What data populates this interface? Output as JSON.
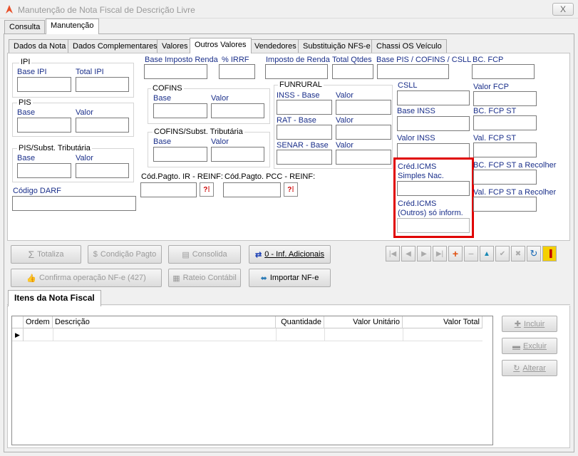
{
  "window": {
    "title": "Manutenção de Nota Fiscal de Descrição Livre",
    "close": "X"
  },
  "top_tabs": [
    "Consulta",
    "Manutenção"
  ],
  "sub_tabs": [
    "Dados da Nota",
    "Dados Complementares",
    "Valores",
    "Outros Valores",
    "Vendedores",
    "Substituição NFS-e",
    "Chassi OS Veículo"
  ],
  "fields": {
    "ipi": "IPI",
    "base_ipi": "Base IPI",
    "total_ipi": "Total IPI",
    "pis": "PIS",
    "pis_base": "Base",
    "pis_valor": "Valor",
    "pis_subst": "PIS/Subst. Tributária",
    "pis_subst_base": "Base",
    "pis_subst_valor": "Valor",
    "codigo_darf": "Código DARF",
    "base_ir": "Base Imposto Renda",
    "irrf": "% IRRF",
    "imposto_renda": "Imposto de Renda",
    "total_qtdes": "Total Qtdes",
    "base_pis_cofins_csll": "Base PIS / COFINS / CSLL",
    "bc_fcp": "BC. FCP",
    "cofins": "COFINS",
    "cofins_base": "Base",
    "cofins_valor": "Valor",
    "cofins_subst": "COFINS/Subst. Tributária",
    "cofins_subst_base": "Base",
    "cofins_subst_valor": "Valor",
    "funrural": "FUNRURAL",
    "inss_base": "INSS - Base",
    "inss_valor": "Valor",
    "rat_base": "RAT - Base",
    "rat_valor": "Valor",
    "senar_base": "SENAR - Base",
    "senar_valor": "Valor",
    "csll": "CSLL",
    "valor_fcp": "Valor FCP",
    "base_inss": "Base INSS",
    "bc_fcp_st": "BC. FCP ST",
    "valor_inss": "Valor INSS",
    "val_fcp_st": "Val. FCP ST",
    "cred_icms_simples_1": "Créd.ICMS",
    "cred_icms_simples_2": "Simples Nac.",
    "cred_icms_outros_1": "Créd.ICMS",
    "cred_icms_outros_2": "(Outros) só inform.",
    "bc_fcp_st_recolher": "BC. FCP ST a Recolher",
    "val_fcp_st_recolher": "Val. FCP ST a Recolher",
    "cod_ir_reinf": "Cód.Pagto. IR - REINF:",
    "cod_pcc_reinf": "Cód.Pagto. PCC - REINF:"
  },
  "buttons": {
    "totaliza": "Totaliza",
    "condicao_pagto": "Condição Pagto",
    "consolida": "Consolida",
    "inf_adicionais": "0 - Inf. Adicionais",
    "confirma_nfe": "Confirma operação NF-e (427)",
    "rateio": "Rateio Contábil",
    "importar_nfe": "Importar NF-e",
    "incluir": "Incluir",
    "excluir": "Excluir",
    "alterar": "Alterar"
  },
  "items": {
    "tab": "Itens da Nota Fiscal",
    "columns": [
      "Ordem",
      "Descrição",
      "Quantidade",
      "Valor Unitário",
      "Valor Total"
    ]
  },
  "colors": {
    "highlight": "#e00000",
    "label_blue": "#1a2f8a"
  }
}
